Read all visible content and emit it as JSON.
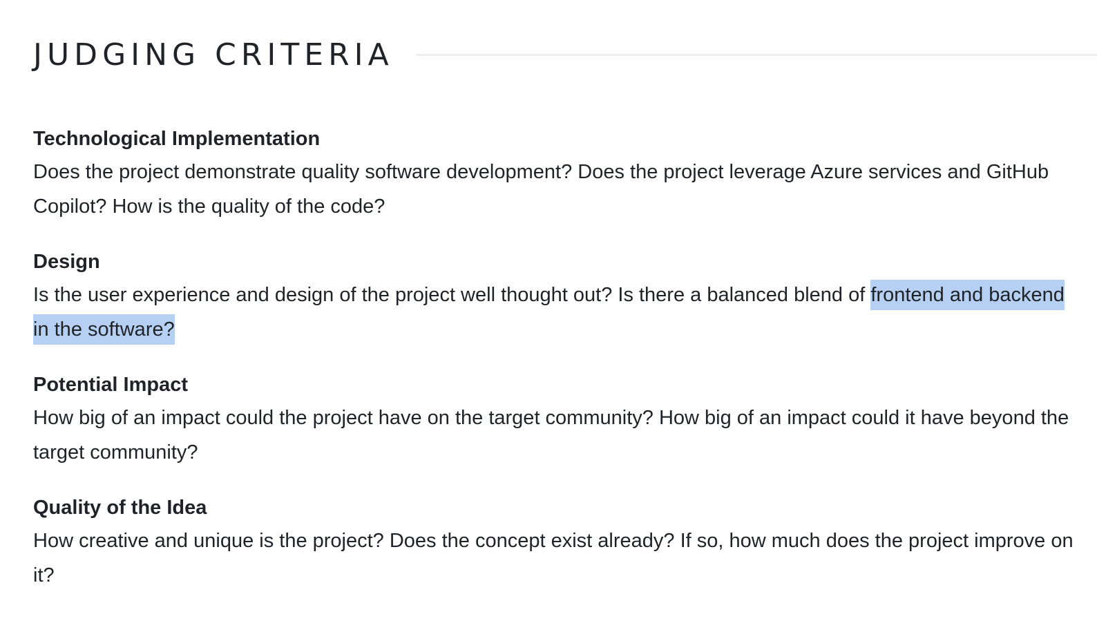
{
  "section": {
    "title": "JUDGING CRITERIA"
  },
  "criteria": [
    {
      "title": "Technological Implementation",
      "description": "Does the project demonstrate quality software development? Does the project leverage Azure services and GitHub Copilot? How is the quality of the code?"
    },
    {
      "title": "Design",
      "description_before": "Is the user experience and design of the project well thought out? Is there a balanced blend of",
      "description_selected": "frontend and backend in the software?"
    },
    {
      "title": "Potential Impact",
      "description": "How big of an impact could the project have on the target community? How big of an impact could it have beyond the target community?"
    },
    {
      "title": "Quality of the Idea",
      "description": "How creative and unique is the project? Does the concept exist already? If so, how much does the project improve on it?"
    }
  ],
  "colors": {
    "text": "#1f2328",
    "selection_highlight": "#b5d0f2",
    "rule": "#eeeeee"
  }
}
